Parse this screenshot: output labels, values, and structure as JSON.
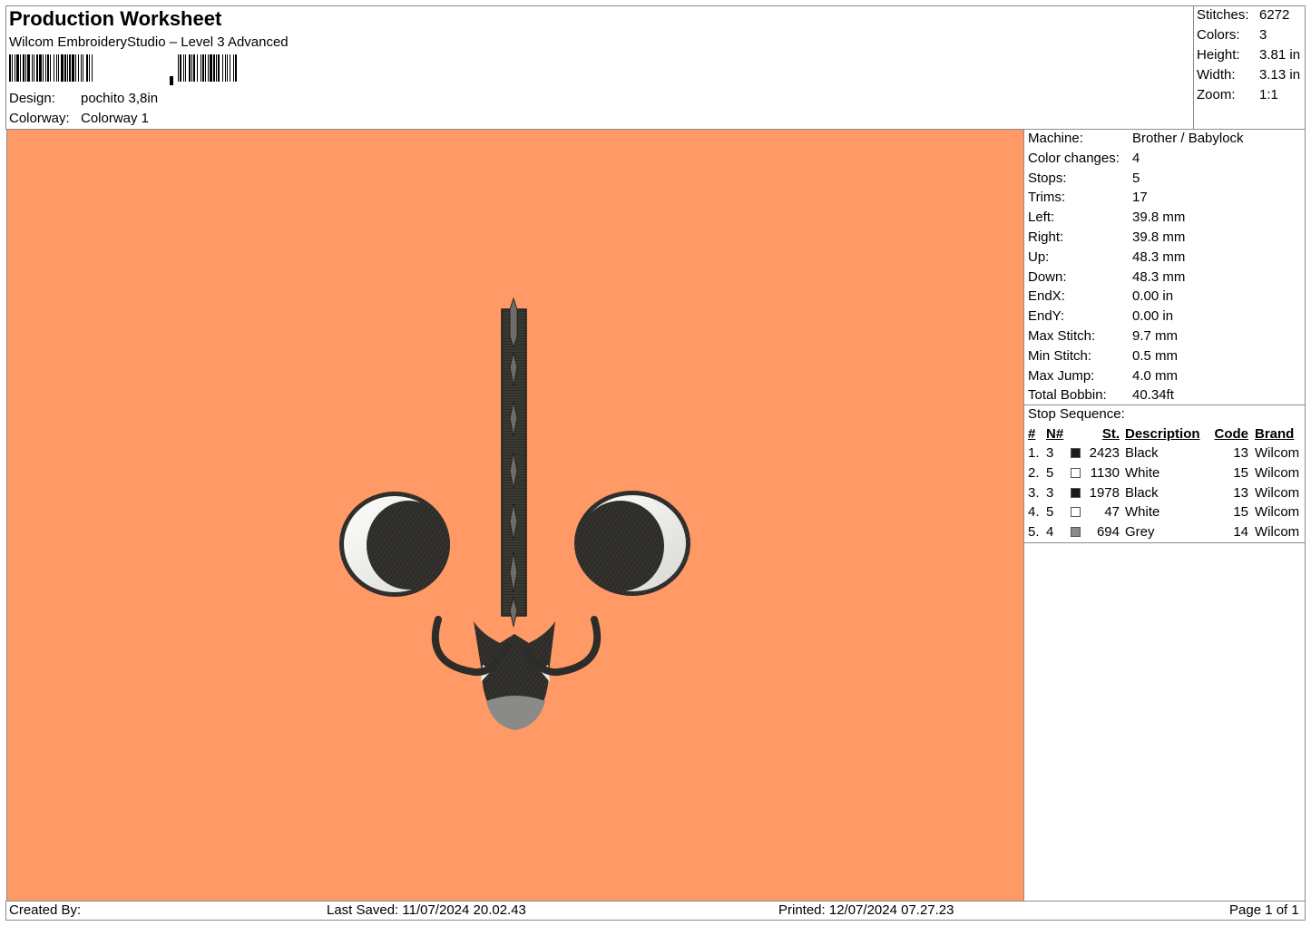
{
  "header": {
    "title": "Production Worksheet",
    "software": "Wilcom EmbroideryStudio – Level 3 Advanced",
    "design_label": "Design:",
    "design_value": "pochito 3,8in",
    "colorway_label": "Colorway:",
    "colorway_value": "Colorway 1"
  },
  "summary": [
    {
      "label": "Stitches:",
      "value": "6272"
    },
    {
      "label": "Colors:",
      "value": "3"
    },
    {
      "label": "Height:",
      "value": "3.81 in"
    },
    {
      "label": "Width:",
      "value": "3.13 in"
    },
    {
      "label": "Zoom:",
      "value": "1:1"
    }
  ],
  "details": [
    {
      "label": "Machine:",
      "value": "Brother / Babylock"
    },
    {
      "label": "Color changes:",
      "value": "4"
    },
    {
      "label": "Stops:",
      "value": "5"
    },
    {
      "label": "Trims:",
      "value": "17"
    },
    {
      "label": "Left:",
      "value": "39.8 mm"
    },
    {
      "label": "Right:",
      "value": "39.8 mm"
    },
    {
      "label": "Up:",
      "value": "48.3 mm"
    },
    {
      "label": "Down:",
      "value": "48.3 mm"
    },
    {
      "label": "EndX:",
      "value": "0.00 in"
    },
    {
      "label": "EndY:",
      "value": "0.00 in"
    },
    {
      "label": "Max Stitch:",
      "value": "9.7 mm"
    },
    {
      "label": "Min Stitch:",
      "value": "0.5 mm"
    },
    {
      "label": "Max Jump:",
      "value": "4.0 mm"
    },
    {
      "label": "Total Bobbin:",
      "value": "40.34ft"
    }
  ],
  "stop_sequence": {
    "title": "Stop Sequence:",
    "columns": [
      "#",
      "N#",
      "St.",
      "Description",
      "Code",
      "Brand"
    ],
    "rows": [
      {
        "index": "1.",
        "n": "3",
        "color": "#1a1a1a",
        "stitches": "2423",
        "description": "Black",
        "code": "13",
        "brand": "Wilcom"
      },
      {
        "index": "2.",
        "n": "5",
        "color": "#ffffff",
        "stitches": "1130",
        "description": "White",
        "code": "15",
        "brand": "Wilcom"
      },
      {
        "index": "3.",
        "n": "3",
        "color": "#1a1a1a",
        "stitches": "1978",
        "description": "Black",
        "code": "13",
        "brand": "Wilcom"
      },
      {
        "index": "4.",
        "n": "5",
        "color": "#ffffff",
        "stitches": "47",
        "description": "White",
        "code": "15",
        "brand": "Wilcom"
      },
      {
        "index": "5.",
        "n": "4",
        "color": "#8a8a8a",
        "stitches": "694",
        "description": "Grey",
        "code": "14",
        "brand": "Wilcom"
      }
    ]
  },
  "footer": {
    "created_by": "Created By:",
    "last_saved": "Last Saved: 11/07/2024 20.02.43",
    "printed": "Printed: 12/07/2024 07.27.23",
    "page": "Page 1 of 1"
  },
  "colors": {
    "canvas_background": "#ff9966",
    "thread_dark": "#2d2c28",
    "thread_white": "#ececea",
    "thread_grey": "#8a8a8a"
  }
}
